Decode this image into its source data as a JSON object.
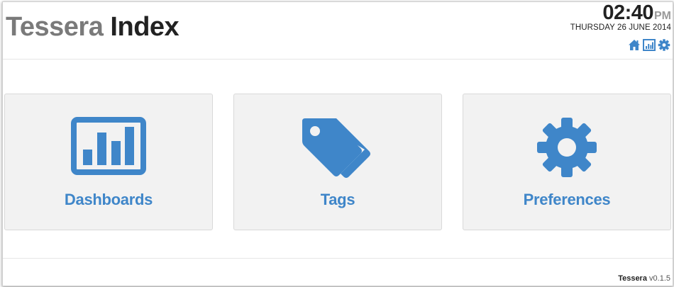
{
  "header": {
    "brand_part1": "Tessera",
    "brand_part2": "Index"
  },
  "clock": {
    "time": "02:40",
    "ampm": "PM",
    "date": "THURSDAY 26 JUNE 2014"
  },
  "header_icons": [
    "home-icon",
    "dashboard-icon",
    "gear-icon"
  ],
  "tiles": [
    {
      "label": "Dashboards",
      "icon": "bar-chart-icon"
    },
    {
      "label": "Tags",
      "icon": "tags-icon"
    },
    {
      "label": "Preferences",
      "icon": "gear-icon"
    }
  ],
  "footer": {
    "app_name": "Tessera",
    "version": "v0.1.5"
  },
  "colors": {
    "accent": "#3f86c9",
    "brand_gray": "#7a7a7a",
    "tile_bg": "#f2f2f2"
  }
}
